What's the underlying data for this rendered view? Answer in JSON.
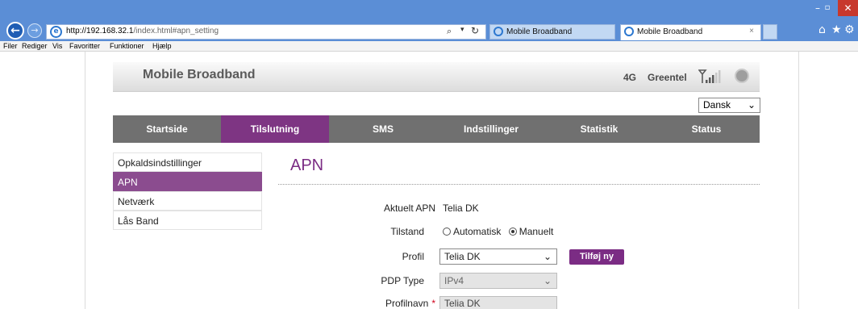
{
  "browser": {
    "url_host": "http://192.168.32.1",
    "url_path": "/index.html#apn_setting",
    "tabs": [
      {
        "label": "Mobile Broadband",
        "active": false
      },
      {
        "label": "Mobile Broadband",
        "active": true,
        "close": "×"
      }
    ],
    "window_buttons": {
      "minimize": "–",
      "maximize": "▫",
      "close": "✕"
    },
    "menu": [
      "Filer",
      "Rediger",
      "Vis",
      "Favoritter",
      "Funktioner",
      "Hjælp"
    ],
    "accent": "#5b8ed6"
  },
  "header": {
    "brand": "Mobile Broadband",
    "network_type": "4G",
    "operator": "Greentel",
    "signal_bars": 3,
    "signal_bars_total": 5
  },
  "language": {
    "selected": "Dansk"
  },
  "main_nav": [
    {
      "label": "Startside",
      "active": false
    },
    {
      "label": "Tilslutning",
      "active": true
    },
    {
      "label": "SMS",
      "active": false
    },
    {
      "label": "Indstillinger",
      "active": false
    },
    {
      "label": "Statistik",
      "active": false
    },
    {
      "label": "Status",
      "active": false
    }
  ],
  "side_nav": [
    {
      "label": "Opkaldsindstillinger",
      "active": false
    },
    {
      "label": "APN",
      "active": true
    },
    {
      "label": "Netværk",
      "active": false
    },
    {
      "label": "Lås Band",
      "active": false
    }
  ],
  "content": {
    "title": "APN",
    "current_apn_label": "Aktuelt APN",
    "current_apn_value": "Telia DK",
    "mode_label": "Tilstand",
    "mode_options": [
      {
        "label": "Automatisk",
        "checked": false
      },
      {
        "label": "Manuelt",
        "checked": true
      }
    ],
    "profile_label": "Profil",
    "profile_value": "Telia DK",
    "add_button": "Tilføj ny",
    "pdp_label": "PDP Type",
    "pdp_value": "IPv4",
    "profile_name_label": "Profilnavn",
    "required_mark": "*",
    "profile_name_value": "Telia DK"
  },
  "colors": {
    "brand_purple": "#7b2c84",
    "nav_gray": "#707070"
  }
}
